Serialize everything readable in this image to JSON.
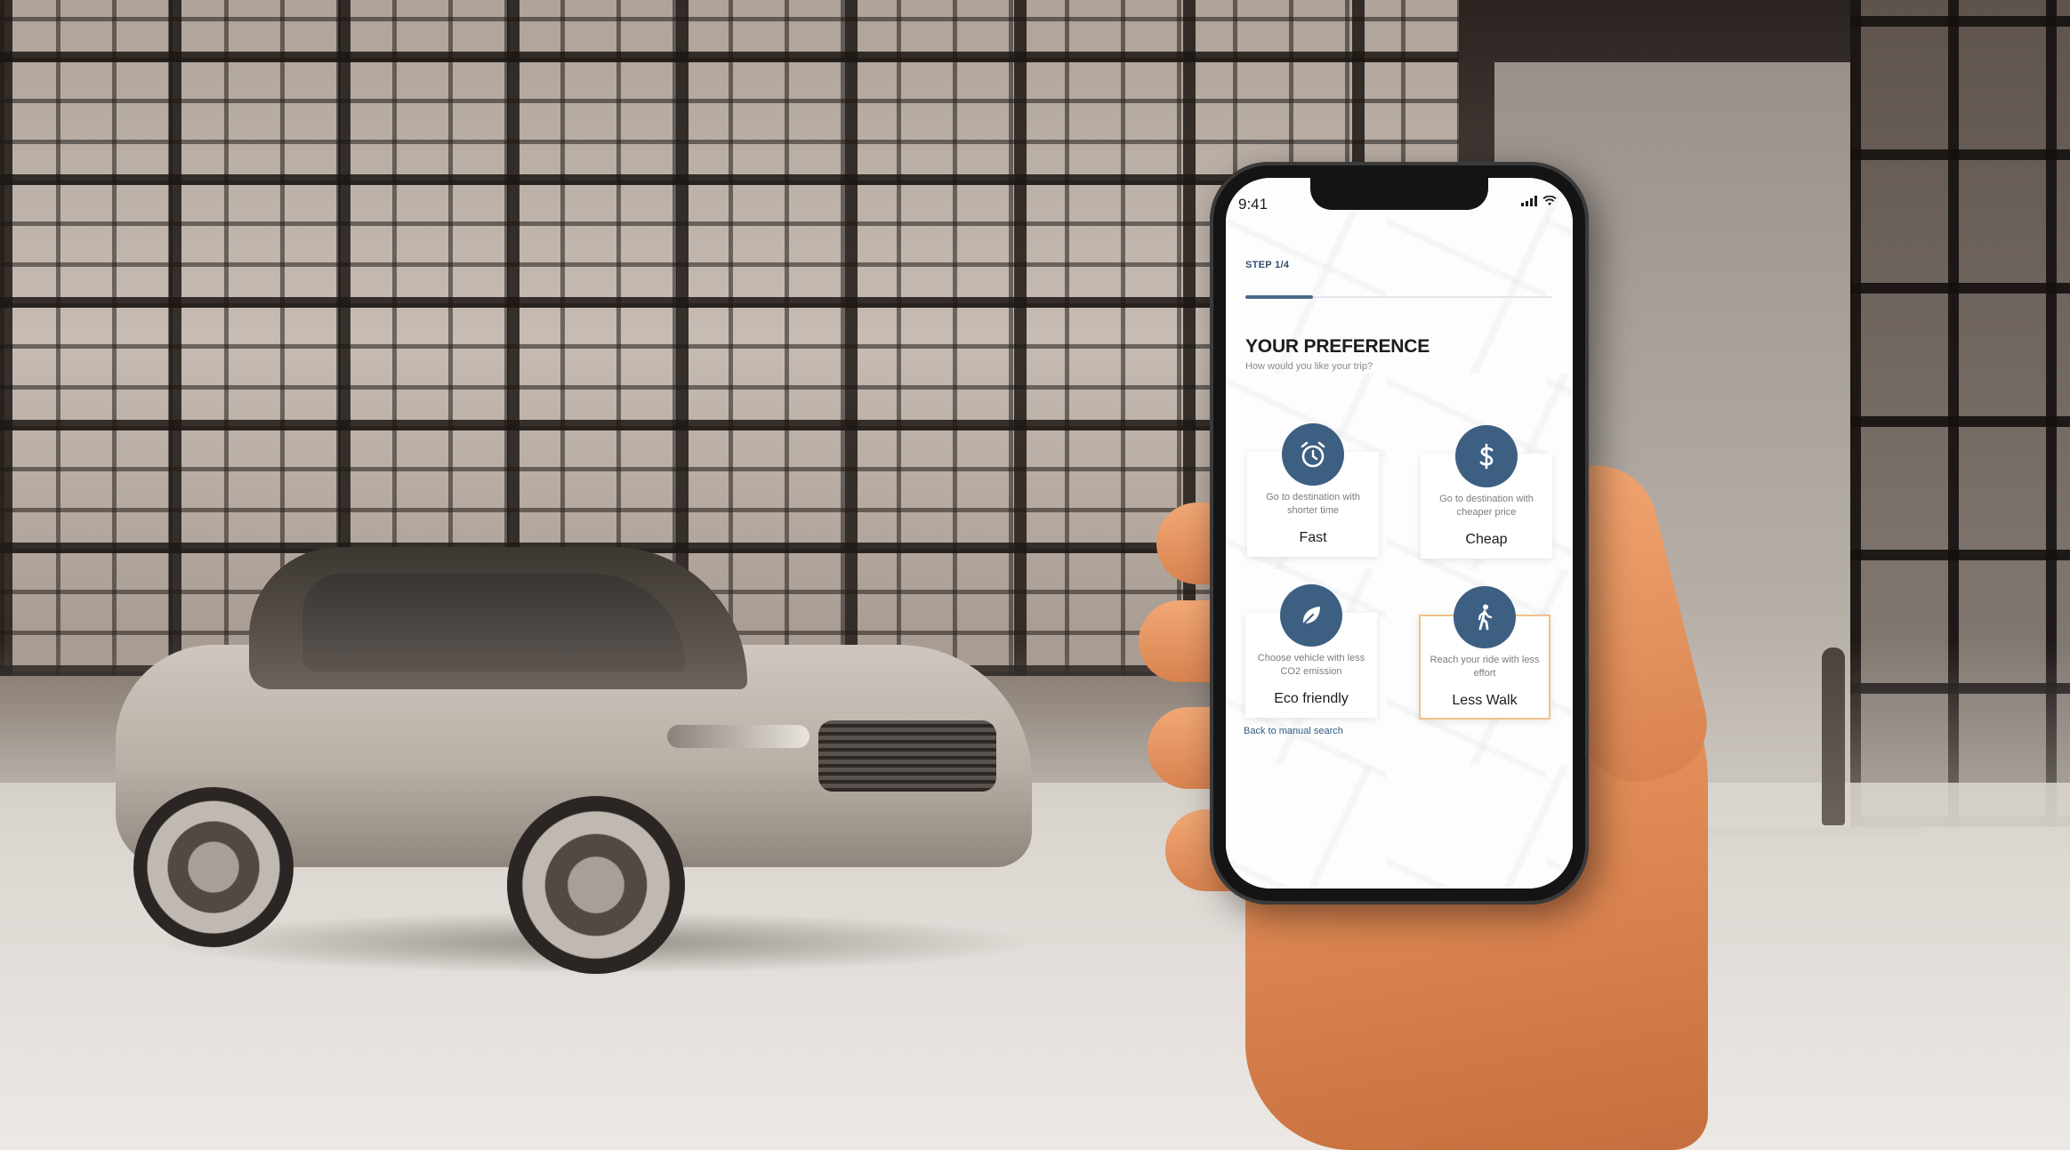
{
  "status_bar": {
    "time": "9:41"
  },
  "onboarding": {
    "step": "STEP 1/4",
    "progress": 0.22,
    "title": "YOUR PREFERENCE",
    "subtitle": "How would you like your trip?",
    "back_link": "Back to manual search",
    "options": [
      {
        "icon": "alarm-clock-icon",
        "description": "Go to destination with shorter time",
        "label": "Fast",
        "selected": false
      },
      {
        "icon": "dollar-icon",
        "description": "Go to destination with cheaper price",
        "label": "Cheap",
        "selected": false
      },
      {
        "icon": "leaf-icon",
        "description": "Choose vehicle with less CO2 emission",
        "label": "Eco friendly",
        "selected": false
      },
      {
        "icon": "walking-person-icon",
        "description": "Reach your ride with less effort",
        "label": "Less Walk",
        "selected": true
      }
    ]
  },
  "colors": {
    "accent": "#3d5f82",
    "selected_border": "#f0c28a",
    "link": "#2f5d86"
  }
}
